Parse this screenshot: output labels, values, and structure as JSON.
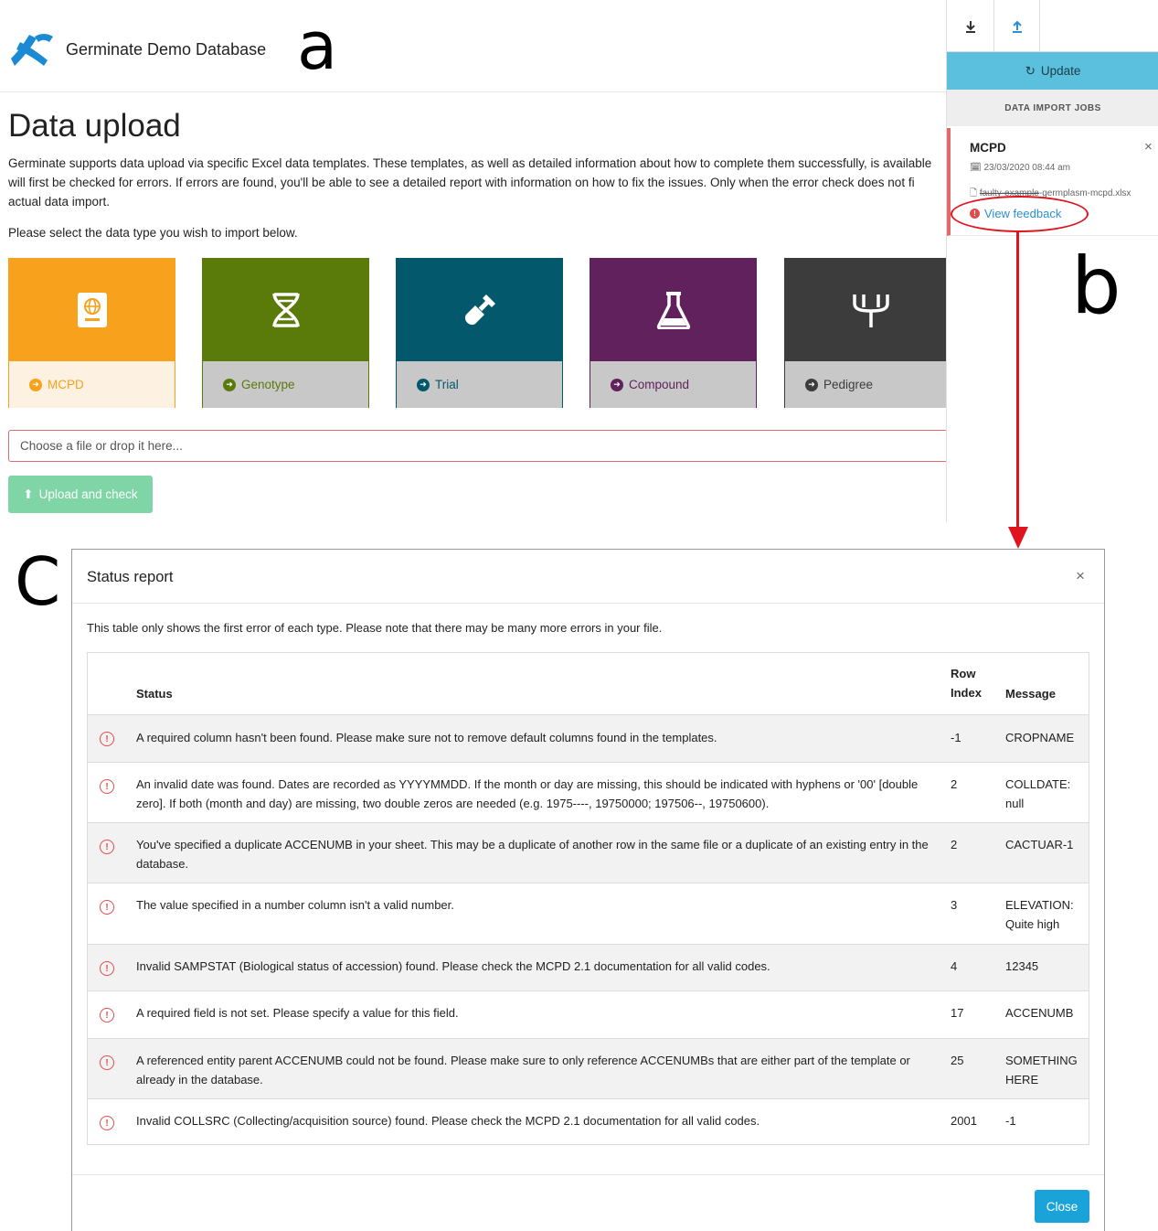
{
  "panel_letters": {
    "a": "a",
    "b": "b",
    "c": "C"
  },
  "app": {
    "title": "Germinate Demo Database",
    "logo_icon": "germinate-logo-icon"
  },
  "page": {
    "title": "Data upload",
    "intro_lines": [
      "Germinate supports data upload via specific Excel data templates. These templates, as well as detailed information about how to complete them successfully, is available",
      "will first be checked for errors. If errors are found, you'll be able to see a detailed report with information on how to fix the issues. Only when the error check does not fi",
      "actual data import."
    ],
    "select_prompt": "Please select the data type you wish to import below."
  },
  "data_types": [
    {
      "label": "MCPD",
      "icon": "passport-globe-icon",
      "color": "#f7a11c"
    },
    {
      "label": "Genotype",
      "icon": "dna-icon",
      "color": "#5a7a0a"
    },
    {
      "label": "Trial",
      "icon": "shovel-icon",
      "color": "#03586b"
    },
    {
      "label": "Compound",
      "icon": "flask-icon",
      "color": "#61215c"
    },
    {
      "label": "Pedigree",
      "icon": "pedigree-icon",
      "color": "#3c3c3c"
    }
  ],
  "upload": {
    "file_placeholder": "Choose a file or drop it here...",
    "button_label": "Upload and check"
  },
  "side_panel": {
    "update_label": "Update",
    "jobs_header": "DATA IMPORT JOBS",
    "job": {
      "title": "MCPD",
      "date": "23/03/2020 08:44 am",
      "file_struck": "faulty-example",
      "file_rest": "-germplasm-mcpd.xlsx",
      "feedback_label": "View feedback"
    }
  },
  "modal": {
    "title": "Status report",
    "note": "This table only shows the first error of each type. Please note that there may be many more errors in your file.",
    "columns": {
      "status": "Status",
      "row_index_1": "Row",
      "row_index_2": "Index",
      "message": "Message"
    },
    "rows": [
      {
        "status": "A required column hasn't been found. Please make sure not to remove default columns found in the templates.",
        "row_index": "-1",
        "message": "CROPNAME"
      },
      {
        "status": "An invalid date was found. Dates are recorded as YYYYMMDD. If the month or day are missing, this should be indicated with hyphens or '00' [double zero]. If both (month and day) are missing, two double zeros are needed (e.g. 1975----, 19750000; 197506--, 19750600).",
        "row_index": "2",
        "message": "COLLDATE: null"
      },
      {
        "status": "You've specified a duplicate ACCENUMB in your sheet. This may be a duplicate of another row in the same file or a duplicate of an existing entry in the database.",
        "row_index": "2",
        "message": "CACTUAR-1"
      },
      {
        "status": "The value specified in a number column isn't a valid number.",
        "row_index": "3",
        "message": "ELEVATION: Quite high"
      },
      {
        "status": "Invalid SAMPSTAT (Biological status of accession) found. Please check the MCPD 2.1 documentation for all valid codes.",
        "row_index": "4",
        "message": "12345"
      },
      {
        "status": "A required field is not set. Please specify a value for this field.",
        "row_index": "17",
        "message": "ACCENUMB"
      },
      {
        "status": "A referenced entity parent ACCENUMB could not be found. Please make sure to only reference ACCENUMBs that are either part of the template or already in the database.",
        "row_index": "25",
        "message": "SOMETHING HERE"
      },
      {
        "status": "Invalid COLLSRC (Collecting/acquisition source) found. Please check the MCPD 2.1 documentation for all valid codes.",
        "row_index": "2001",
        "message": "-1"
      }
    ],
    "close_label": "Close"
  },
  "colors": {
    "annotation_red": "#e0141e",
    "info_blue": "#5bc0de",
    "primary_blue": "#1aa3d9",
    "success_green": "#7fd5a6",
    "error_red": "#e04c4c"
  }
}
